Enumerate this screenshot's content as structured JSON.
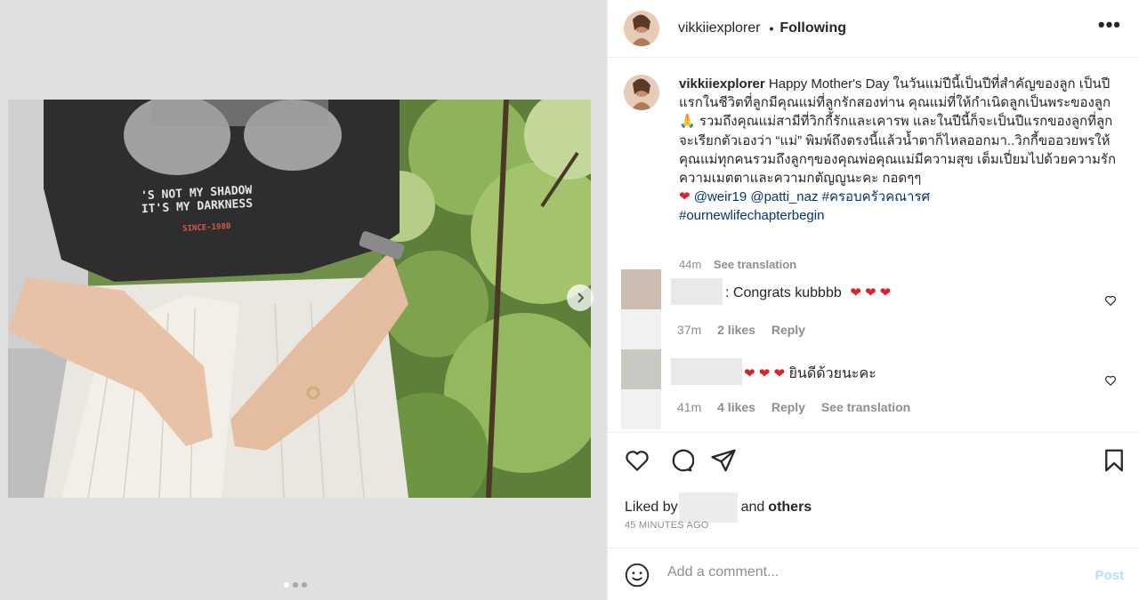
{
  "post": {
    "username": "vikkiiexplorer",
    "separator": "•",
    "follow_state": "Following",
    "more_label": "•••"
  },
  "media": {
    "shirt_text_1": "'S NOT MY SHADOW",
    "shirt_text_2": "IT'S MY DARKNESS",
    "shirt_text_3": "SINCE-1980",
    "slide_count": 3,
    "active_slide": 1
  },
  "caption": {
    "username": "vikkiiexplorer",
    "text": "Happy Mother's Day ในวันแม่ปีนี้เป็นปีที่สำคัญของลูก เป็นปีแรกในชีวิตที่ลูกมีคุณแม่ที่ลูกรักสองท่าน คุณแม่ที่ให้กำเนิดลูกเป็นพระของลูก 🙏 รวมถึงคุณแม่สามีที่วิกกี้รักและเคารพ และในปีนี้ก็จะเป็นปีแรกของลูกที่ลูกจะเรียกตัวเองว่า “แม่” พิมพ์ถึงตรงนี้แล้วน้ำตาก็ไหลออกมา..วิกกี้ขออวยพรให้คุณแม่ทุกคนรวมถึงลูกๆของคุณพ่อคุณแม่มีความสุข เต็มเปี่ยมไปด้วยความรัก ความเมตตาและความกตัญญูนะคะ กอดๆๆ",
    "heart": "❤",
    "mention_1": "@weir19",
    "mention_2": "@patti_naz",
    "hashtag_1": "#ครอบครัวคณารศ",
    "hashtag_2": "#ournewlifechapterbegin",
    "time": "44m",
    "see_translation": "See translation"
  },
  "comments": [
    {
      "text": ": Congrats kubbbb",
      "hearts": "❤ ❤ ❤",
      "time": "37m",
      "likes": "2 likes",
      "reply": "Reply"
    },
    {
      "hearts": "❤ ❤ ❤",
      "text": "ยินดีด้วยนะคะ",
      "time": "41m",
      "likes": "4 likes",
      "reply": "Reply",
      "see_translation": "See translation"
    }
  ],
  "actions": {
    "liked_by_prefix": "Liked by",
    "liked_by_and": "and",
    "liked_by_others": "others",
    "timestamp": "45 MINUTES AGO"
  },
  "add_comment": {
    "placeholder": "Add a comment...",
    "post_label": "Post"
  }
}
